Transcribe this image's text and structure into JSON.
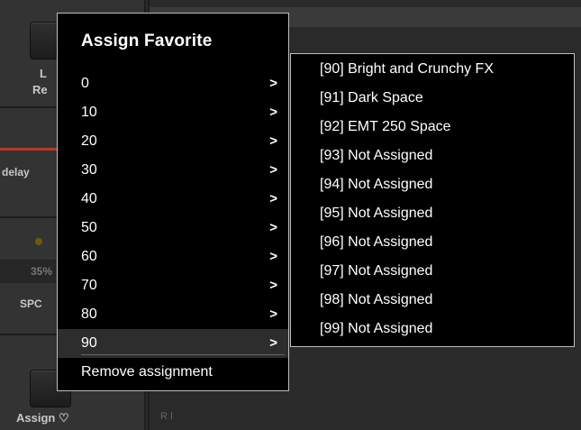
{
  "background": {
    "left_labels": [
      "L",
      "Re"
    ],
    "delay_label": "delay",
    "percent_label": "35%",
    "spc_label": "SPC",
    "assign_label": "Assign ♡",
    "lower_right_text": "R  I"
  },
  "menu": {
    "title": "Assign Favorite",
    "items": [
      {
        "label": "0"
      },
      {
        "label": "10"
      },
      {
        "label": "20"
      },
      {
        "label": "30"
      },
      {
        "label": "40"
      },
      {
        "label": "50"
      },
      {
        "label": "60"
      },
      {
        "label": "70"
      },
      {
        "label": "80"
      },
      {
        "label": "90"
      }
    ],
    "selected_index": 9,
    "chevron": ">",
    "remove_label": "Remove assignment"
  },
  "submenu": {
    "items": [
      {
        "label": "[90] Bright and Crunchy FX"
      },
      {
        "label": "[91] Dark Space"
      },
      {
        "label": "[92] EMT 250 Space"
      },
      {
        "label": "[93] Not Assigned"
      },
      {
        "label": "[94] Not Assigned"
      },
      {
        "label": "[95] Not Assigned"
      },
      {
        "label": "[96] Not Assigned"
      },
      {
        "label": "[97] Not Assigned"
      },
      {
        "label": "[98] Not Assigned"
      },
      {
        "label": "[99] Not Assigned"
      }
    ]
  }
}
